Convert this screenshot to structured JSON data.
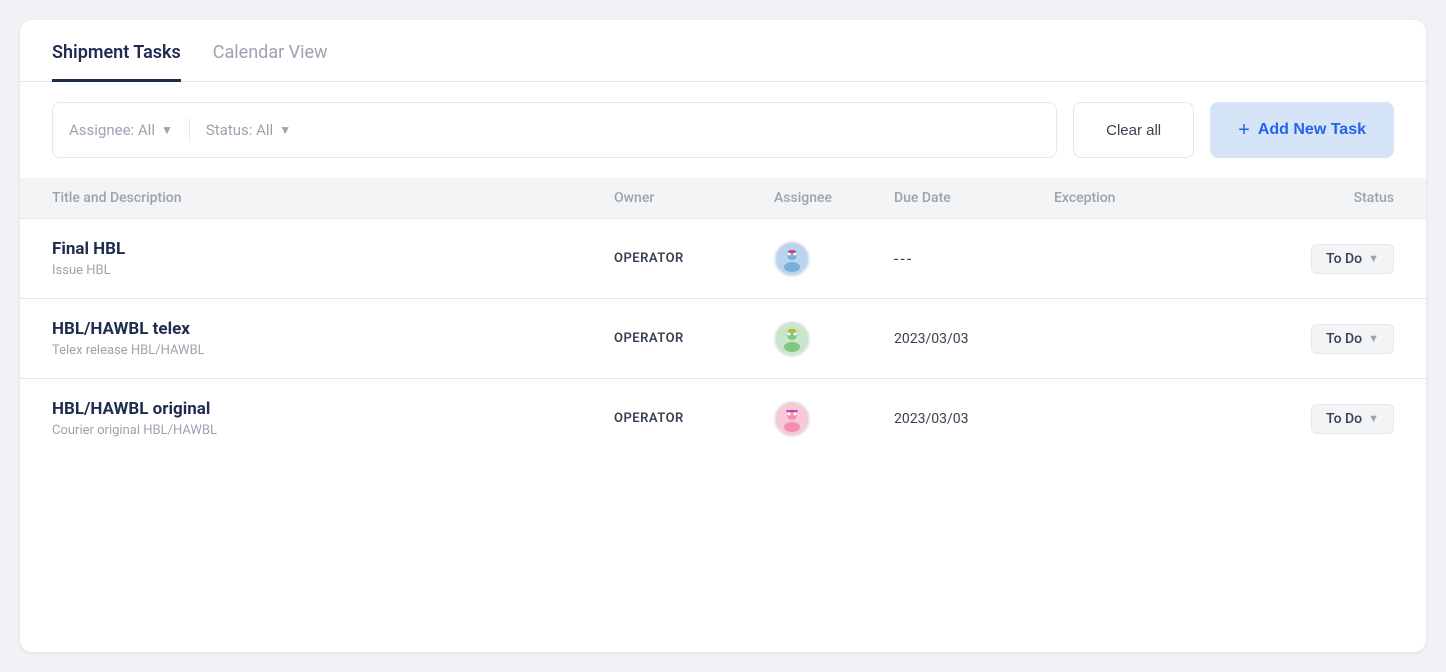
{
  "tabs": [
    {
      "id": "shipment-tasks",
      "label": "Shipment Tasks",
      "active": true
    },
    {
      "id": "calendar-view",
      "label": "Calendar View",
      "active": false
    }
  ],
  "toolbar": {
    "assignee_filter_label": "Assignee: All",
    "status_filter_label": "Status: All",
    "clear_all_label": "Clear all",
    "add_task_label": "Add New Task",
    "plus_symbol": "+"
  },
  "table": {
    "headers": {
      "title": "Title and Description",
      "owner": "Owner",
      "assignee": "Assignee",
      "due_date": "Due Date",
      "exception": "Exception",
      "status": "Status"
    },
    "rows": [
      {
        "id": "row-1",
        "title": "Final HBL",
        "description": "Issue HBL",
        "owner": "OPERATOR",
        "assignee_emoji": "🧑‍💻",
        "due_date": "---",
        "due_date_empty": true,
        "exception": "",
        "status": "To Do"
      },
      {
        "id": "row-2",
        "title": "HBL/HAWBL telex",
        "description": "Telex release HBL/HAWBL",
        "owner": "OPERATOR",
        "assignee_emoji": "🧑‍💻",
        "due_date": "2023/03/03",
        "due_date_empty": false,
        "exception": "",
        "status": "To Do"
      },
      {
        "id": "row-3",
        "title": "HBL/HAWBL original",
        "description": "Courier original HBL/HAWBL",
        "owner": "OPERATOR",
        "assignee_emoji": "🧑‍💻",
        "due_date": "2023/03/03",
        "due_date_empty": false,
        "exception": "",
        "status": "To Do"
      }
    ]
  }
}
